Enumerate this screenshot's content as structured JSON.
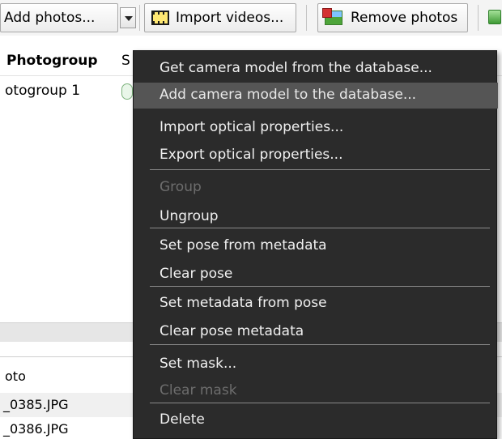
{
  "toolbar": {
    "add_photos": "Add photos...",
    "import_videos": "Import videos...",
    "remove_photos": "Remove photos"
  },
  "table": {
    "columns": [
      "Photogroup",
      "S"
    ],
    "rows": [
      "otogroup 1"
    ]
  },
  "lower_panel": {
    "header": "oto",
    "rows": [
      "_0385.JPG",
      "_0386.JPG"
    ]
  },
  "context_menu": {
    "items": [
      {
        "label": "Get camera model from the database...",
        "enabled": true,
        "highlighted": false
      },
      {
        "label": "Add camera model to the database...",
        "enabled": true,
        "highlighted": true
      },
      {
        "label": "Import optical properties...",
        "enabled": true,
        "highlighted": false
      },
      {
        "label": "Export optical properties...",
        "enabled": true,
        "highlighted": false
      },
      {
        "label": "Group",
        "enabled": false,
        "highlighted": false
      },
      {
        "label": "Ungroup",
        "enabled": true,
        "highlighted": false
      },
      {
        "label": "Set pose from metadata",
        "enabled": true,
        "highlighted": false
      },
      {
        "label": "Clear pose",
        "enabled": true,
        "highlighted": false
      },
      {
        "label": "Set metadata from pose",
        "enabled": true,
        "highlighted": false
      },
      {
        "label": "Clear pose metadata",
        "enabled": true,
        "highlighted": false
      },
      {
        "label": "Set mask...",
        "enabled": true,
        "highlighted": false
      },
      {
        "label": "Clear mask",
        "enabled": false,
        "highlighted": false
      },
      {
        "label": "Delete",
        "enabled": true,
        "highlighted": false
      }
    ]
  },
  "icons": [
    "film-icon",
    "photos-icon",
    "dropdown-arrow-icon",
    "status-icon"
  ],
  "colors": {
    "menu_bg": "#2b2b2b",
    "menu_highlight": "#555555",
    "menu_text": "#f0f0f0",
    "menu_disabled": "#6d6d6d"
  }
}
